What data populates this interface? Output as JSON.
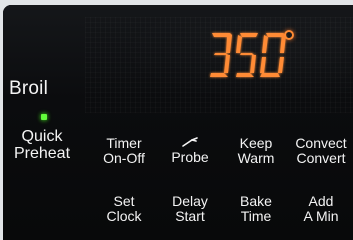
{
  "display": {
    "temperature": "350",
    "unit_symbol": "°",
    "digit_color": "#ff8b34"
  },
  "broil": {
    "label": "Broil",
    "indicator_color": "#62ff3b"
  },
  "buttons": {
    "quick_preheat": {
      "line1": "Quick",
      "line2": "Preheat"
    },
    "timer_on_off": {
      "line1": "Timer",
      "line2": "On-Off"
    },
    "probe": {
      "label": "Probe",
      "icon": "probe-icon"
    },
    "keep_warm": {
      "line1": "Keep",
      "line2": "Warm"
    },
    "convect_convert": {
      "line1": "Convect",
      "line2": "Convert"
    },
    "set_clock": {
      "line1": "Set",
      "line2": "Clock"
    },
    "delay_start": {
      "line1": "Delay",
      "line2": "Start"
    },
    "bake_time": {
      "line1": "Bake",
      "line2": "Time"
    },
    "add_a_min": {
      "line1": "Add",
      "line2": "A Min"
    }
  }
}
